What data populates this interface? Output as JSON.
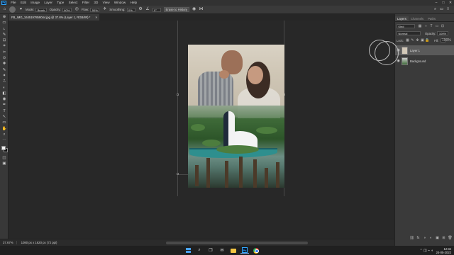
{
  "menubar": {
    "logo": "Ps",
    "items": [
      "File",
      "Edit",
      "Image",
      "Layer",
      "Type",
      "Select",
      "Filter",
      "3D",
      "View",
      "Window",
      "Help"
    ],
    "window_controls": [
      "–",
      "□",
      "✕"
    ]
  },
  "options_bar": {
    "mode_label": "Mode:",
    "mode_value": "Brush",
    "opacity_label": "Opacity:",
    "opacity_value": "60%",
    "flow_label": "Flow:",
    "flow_value": "50%",
    "smoothing_label": "Smoothing:",
    "smoothing_value": "0%",
    "angle_value": "0°",
    "erase_history_label": "Erase to History"
  },
  "document": {
    "tab_title": "FB_IMG_1645197859044.jpg @ 37.6% (Layer 1, RGB/8#) *"
  },
  "toolbar": {
    "tools": [
      "⊕",
      "▭",
      "ʟ",
      "✎",
      "⊡",
      "⌗",
      "✂",
      "⊙",
      "✚",
      "✎",
      "✦",
      "⎍",
      "◐",
      "◧",
      "◉",
      "✒",
      "T",
      "↖",
      "▭",
      "✋",
      "⌕",
      "⋯"
    ]
  },
  "panel": {
    "tabs": [
      "Layers",
      "Channels",
      "Paths"
    ],
    "kind_value": "Kind",
    "blend_mode": "Normal",
    "opacity_label": "Opacity:",
    "opacity_value": "100%",
    "lock_label": "Lock:",
    "fill_label": "Fill:",
    "fill_value": "100%",
    "layers": [
      {
        "name": "Layer 1",
        "selected": true
      },
      {
        "name": "Background",
        "selected": false
      }
    ],
    "footer_icons": [
      "⛓",
      "fx",
      "◑",
      "◐",
      "▣",
      "⊞",
      "🗑"
    ]
  },
  "status": {
    "zoom": "37.67%",
    "doc_info": "1080 px x 1620 px (72 ppi)"
  },
  "taskbar": {
    "time": "12:34",
    "date": "24-05-2022"
  }
}
